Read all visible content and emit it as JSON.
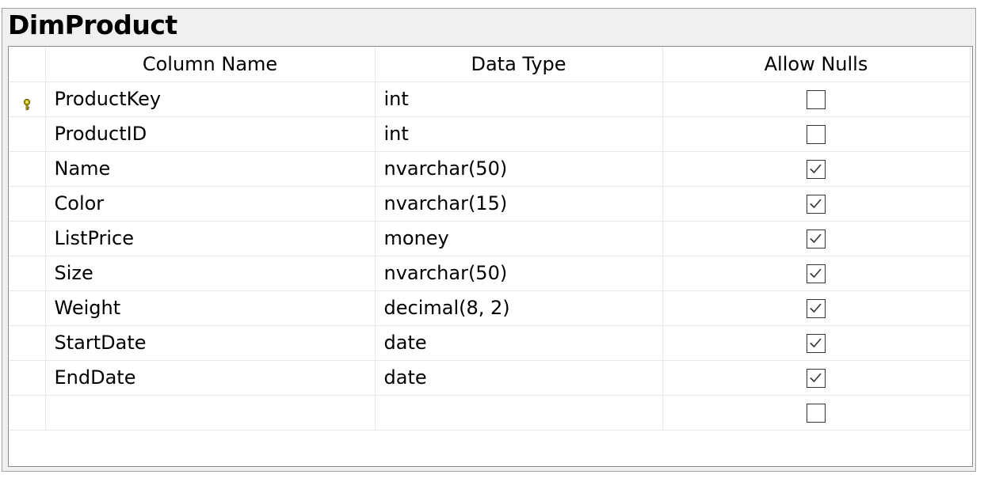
{
  "table_designer": {
    "title": "DimProduct",
    "headers": {
      "column_name": "Column Name",
      "data_type": "Data Type",
      "allow_nulls": "Allow Nulls"
    },
    "rows": [
      {
        "column_name": "ProductKey",
        "data_type": "int",
        "allow_nulls": false,
        "primary_key": true
      },
      {
        "column_name": "ProductID",
        "data_type": "int",
        "allow_nulls": false,
        "primary_key": false
      },
      {
        "column_name": "Name",
        "data_type": "nvarchar(50)",
        "allow_nulls": true,
        "primary_key": false
      },
      {
        "column_name": "Color",
        "data_type": "nvarchar(15)",
        "allow_nulls": true,
        "primary_key": false
      },
      {
        "column_name": "ListPrice",
        "data_type": "money",
        "allow_nulls": true,
        "primary_key": false
      },
      {
        "column_name": "Size",
        "data_type": "nvarchar(50)",
        "allow_nulls": true,
        "primary_key": false
      },
      {
        "column_name": "Weight",
        "data_type": "decimal(8, 2)",
        "allow_nulls": true,
        "primary_key": false
      },
      {
        "column_name": "StartDate",
        "data_type": "date",
        "allow_nulls": true,
        "primary_key": false
      },
      {
        "column_name": "EndDate",
        "data_type": "date",
        "allow_nulls": true,
        "primary_key": false
      },
      {
        "column_name": "",
        "data_type": "",
        "allow_nulls": false,
        "primary_key": false
      }
    ],
    "colors": {
      "key_icon": "#c8b400",
      "grid_line": "#e8e8e8",
      "frame_bg": "#f0f0f0"
    }
  }
}
